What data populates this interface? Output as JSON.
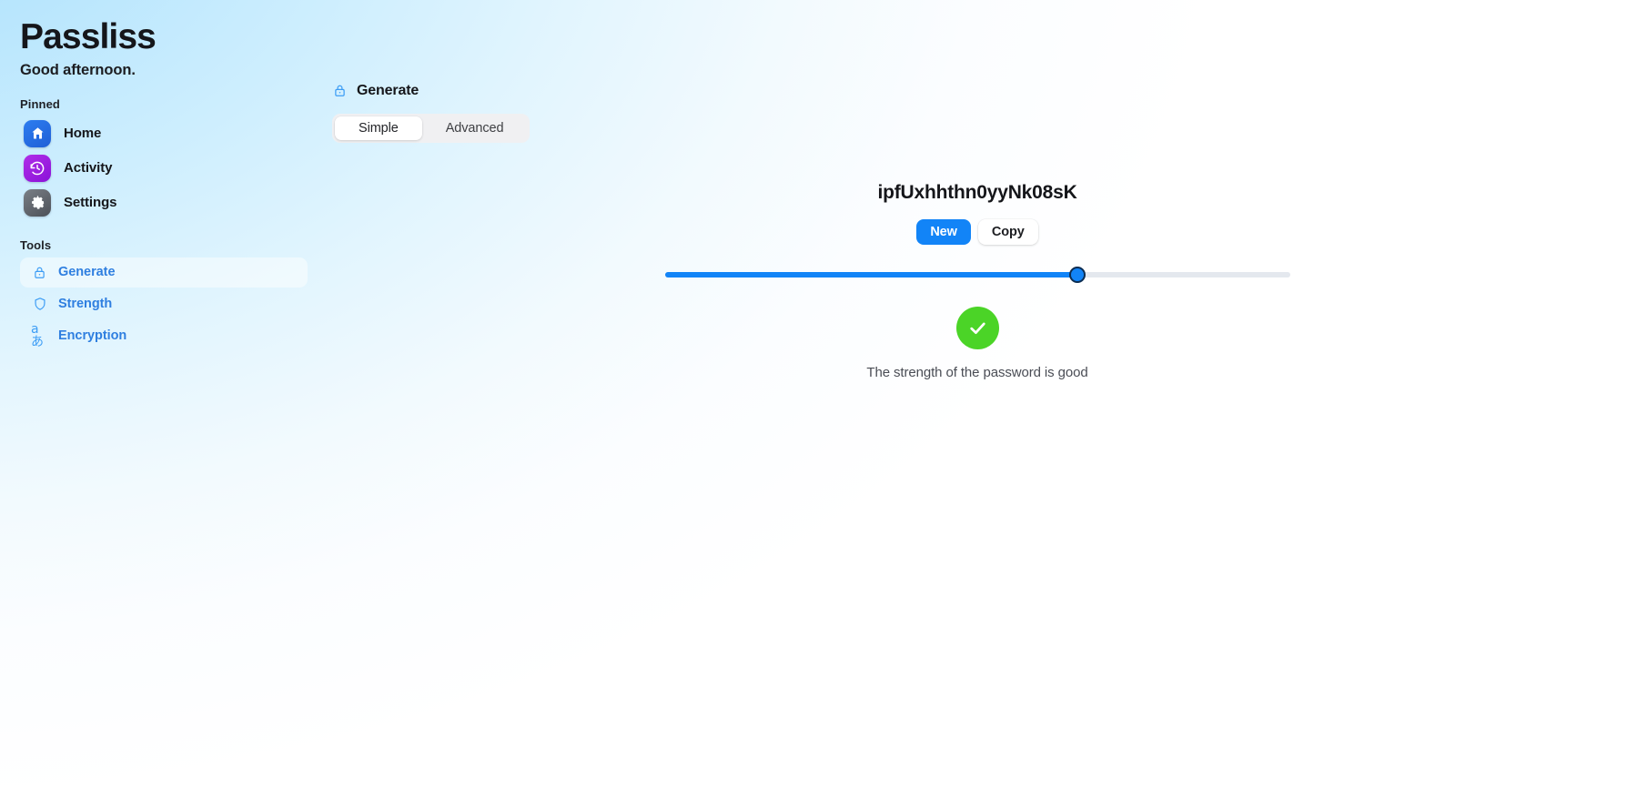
{
  "app": {
    "title": "Passliss",
    "greeting": "Good afternoon."
  },
  "sidebar": {
    "pinned_label": "Pinned",
    "tools_label": "Tools",
    "pinned": [
      {
        "label": "Home",
        "icon": "home-icon"
      },
      {
        "label": "Activity",
        "icon": "history-clock-icon"
      },
      {
        "label": "Settings",
        "icon": "gear-icon"
      }
    ],
    "tools": [
      {
        "label": "Generate",
        "icon": "lock-icon",
        "active": true
      },
      {
        "label": "Strength",
        "icon": "shield-icon",
        "active": false
      },
      {
        "label": "Encryption",
        "icon": "language-translate-icon",
        "active": false
      }
    ]
  },
  "main": {
    "header": {
      "title": "Generate",
      "icon": "lock-icon"
    },
    "tabs": [
      {
        "label": "Simple",
        "active": true
      },
      {
        "label": "Advanced",
        "active": false
      }
    ],
    "generator": {
      "password": "ipfUxhhthn0yyNk08sK",
      "new_button": "New",
      "copy_button": "Copy",
      "length_slider": {
        "percent": 66,
        "icon": "slider-thumb-icon"
      },
      "strength": {
        "icon": "checkmark-icon",
        "message": "The strength of the password is good",
        "color": "#4bd427"
      }
    }
  },
  "colors": {
    "accent_blue": "#1284f7",
    "link_blue": "#2f7fe0",
    "icon_blue": "#3d9df5",
    "success_green": "#4bd427",
    "text_dark": "#15161a",
    "bg_top_left": "#a9e0fc"
  }
}
